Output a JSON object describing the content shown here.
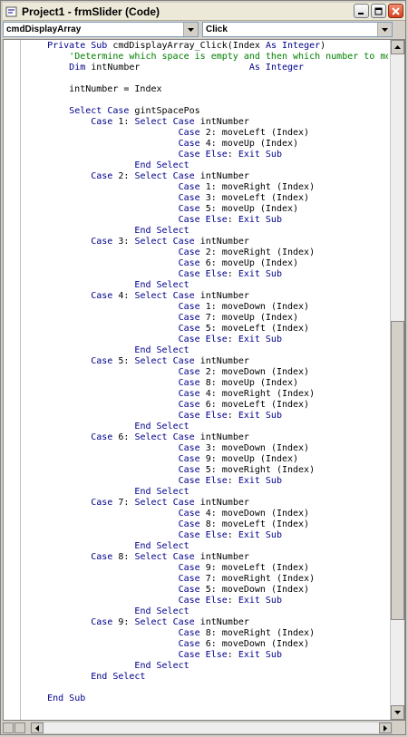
{
  "window": {
    "title": "Project1 - frmSlider (Code)"
  },
  "toolbar": {
    "object_combo": "cmdDisplayArray",
    "procedure_combo": "Click"
  },
  "colors": {
    "keyword": "#00008b",
    "comment": "#008000",
    "text": "#000000"
  },
  "code": [
    [
      {
        "t": "    "
      },
      {
        "t": "Private Sub",
        "k": 1
      },
      {
        "t": " cmdDisplayArray_Click(Index "
      },
      {
        "t": "As Integer",
        "k": 1
      },
      {
        "t": ")"
      }
    ],
    [
      {
        "t": "        "
      },
      {
        "t": "'Determine which space is empty and then which number to move",
        "c": 1
      }
    ],
    [
      {
        "t": "        "
      },
      {
        "t": "Dim",
        "k": 1
      },
      {
        "t": " intNumber                    "
      },
      {
        "t": "As Integer",
        "k": 1
      }
    ],
    [
      {
        "t": ""
      }
    ],
    [
      {
        "t": "        intNumber = Index"
      }
    ],
    [
      {
        "t": ""
      }
    ],
    [
      {
        "t": "        "
      },
      {
        "t": "Select Case",
        "k": 1
      },
      {
        "t": " gintSpacePos"
      }
    ],
    [
      {
        "t": "            "
      },
      {
        "t": "Case",
        "k": 1
      },
      {
        "t": " 1: "
      },
      {
        "t": "Select Case",
        "k": 1
      },
      {
        "t": " intNumber"
      }
    ],
    [
      {
        "t": "                            "
      },
      {
        "t": "Case",
        "k": 1
      },
      {
        "t": " 2: moveLeft (Index)"
      }
    ],
    [
      {
        "t": "                            "
      },
      {
        "t": "Case",
        "k": 1
      },
      {
        "t": " 4: moveUp (Index)"
      }
    ],
    [
      {
        "t": "                            "
      },
      {
        "t": "Case Else",
        "k": 1
      },
      {
        "t": ": "
      },
      {
        "t": "Exit Sub",
        "k": 1
      }
    ],
    [
      {
        "t": "                    "
      },
      {
        "t": "End Select",
        "k": 1
      }
    ],
    [
      {
        "t": "            "
      },
      {
        "t": "Case",
        "k": 1
      },
      {
        "t": " 2: "
      },
      {
        "t": "Select Case",
        "k": 1
      },
      {
        "t": " intNumber"
      }
    ],
    [
      {
        "t": "                            "
      },
      {
        "t": "Case",
        "k": 1
      },
      {
        "t": " 1: moveRight (Index)"
      }
    ],
    [
      {
        "t": "                            "
      },
      {
        "t": "Case",
        "k": 1
      },
      {
        "t": " 3: moveLeft (Index)"
      }
    ],
    [
      {
        "t": "                            "
      },
      {
        "t": "Case",
        "k": 1
      },
      {
        "t": " 5: moveUp (Index)"
      }
    ],
    [
      {
        "t": "                            "
      },
      {
        "t": "Case Else",
        "k": 1
      },
      {
        "t": ": "
      },
      {
        "t": "Exit Sub",
        "k": 1
      }
    ],
    [
      {
        "t": "                    "
      },
      {
        "t": "End Select",
        "k": 1
      }
    ],
    [
      {
        "t": "            "
      },
      {
        "t": "Case",
        "k": 1
      },
      {
        "t": " 3: "
      },
      {
        "t": "Select Case",
        "k": 1
      },
      {
        "t": " intNumber"
      }
    ],
    [
      {
        "t": "                            "
      },
      {
        "t": "Case",
        "k": 1
      },
      {
        "t": " 2: moveRight (Index)"
      }
    ],
    [
      {
        "t": "                            "
      },
      {
        "t": "Case",
        "k": 1
      },
      {
        "t": " 6: moveUp (Index)"
      }
    ],
    [
      {
        "t": "                            "
      },
      {
        "t": "Case Else",
        "k": 1
      },
      {
        "t": ": "
      },
      {
        "t": "Exit Sub",
        "k": 1
      }
    ],
    [
      {
        "t": "                    "
      },
      {
        "t": "End Select",
        "k": 1
      }
    ],
    [
      {
        "t": "            "
      },
      {
        "t": "Case",
        "k": 1
      },
      {
        "t": " 4: "
      },
      {
        "t": "Select Case",
        "k": 1
      },
      {
        "t": " intNumber"
      }
    ],
    [
      {
        "t": "                            "
      },
      {
        "t": "Case",
        "k": 1
      },
      {
        "t": " 1: moveDown (Index)"
      }
    ],
    [
      {
        "t": "                            "
      },
      {
        "t": "Case",
        "k": 1
      },
      {
        "t": " 7: moveUp (Index)"
      }
    ],
    [
      {
        "t": "                            "
      },
      {
        "t": "Case",
        "k": 1
      },
      {
        "t": " 5: moveLeft (Index)"
      }
    ],
    [
      {
        "t": "                            "
      },
      {
        "t": "Case Else",
        "k": 1
      },
      {
        "t": ": "
      },
      {
        "t": "Exit Sub",
        "k": 1
      }
    ],
    [
      {
        "t": "                    "
      },
      {
        "t": "End Select",
        "k": 1
      }
    ],
    [
      {
        "t": "            "
      },
      {
        "t": "Case",
        "k": 1
      },
      {
        "t": " 5: "
      },
      {
        "t": "Select Case",
        "k": 1
      },
      {
        "t": " intNumber"
      }
    ],
    [
      {
        "t": "                            "
      },
      {
        "t": "Case",
        "k": 1
      },
      {
        "t": " 2: moveDown (Index)"
      }
    ],
    [
      {
        "t": "                            "
      },
      {
        "t": "Case",
        "k": 1
      },
      {
        "t": " 8: moveUp (Index)"
      }
    ],
    [
      {
        "t": "                            "
      },
      {
        "t": "Case",
        "k": 1
      },
      {
        "t": " 4: moveRight (Index)"
      }
    ],
    [
      {
        "t": "                            "
      },
      {
        "t": "Case",
        "k": 1
      },
      {
        "t": " 6: moveLeft (Index)"
      }
    ],
    [
      {
        "t": "                            "
      },
      {
        "t": "Case Else",
        "k": 1
      },
      {
        "t": ": "
      },
      {
        "t": "Exit Sub",
        "k": 1
      }
    ],
    [
      {
        "t": "                    "
      },
      {
        "t": "End Select",
        "k": 1
      }
    ],
    [
      {
        "t": "            "
      },
      {
        "t": "Case",
        "k": 1
      },
      {
        "t": " 6: "
      },
      {
        "t": "Select Case",
        "k": 1
      },
      {
        "t": " intNumber"
      }
    ],
    [
      {
        "t": "                            "
      },
      {
        "t": "Case",
        "k": 1
      },
      {
        "t": " 3: moveDown (Index)"
      }
    ],
    [
      {
        "t": "                            "
      },
      {
        "t": "Case",
        "k": 1
      },
      {
        "t": " 9: moveUp (Index)"
      }
    ],
    [
      {
        "t": "                            "
      },
      {
        "t": "Case",
        "k": 1
      },
      {
        "t": " 5: moveRight (Index)"
      }
    ],
    [
      {
        "t": "                            "
      },
      {
        "t": "Case Else",
        "k": 1
      },
      {
        "t": ": "
      },
      {
        "t": "Exit Sub",
        "k": 1
      }
    ],
    [
      {
        "t": "                    "
      },
      {
        "t": "End Select",
        "k": 1
      }
    ],
    [
      {
        "t": "            "
      },
      {
        "t": "Case",
        "k": 1
      },
      {
        "t": " 7: "
      },
      {
        "t": "Select Case",
        "k": 1
      },
      {
        "t": " intNumber"
      }
    ],
    [
      {
        "t": "                            "
      },
      {
        "t": "Case",
        "k": 1
      },
      {
        "t": " 4: moveDown (Index)"
      }
    ],
    [
      {
        "t": "                            "
      },
      {
        "t": "Case",
        "k": 1
      },
      {
        "t": " 8: moveLeft (Index)"
      }
    ],
    [
      {
        "t": "                            "
      },
      {
        "t": "Case Else",
        "k": 1
      },
      {
        "t": ": "
      },
      {
        "t": "Exit Sub",
        "k": 1
      }
    ],
    [
      {
        "t": "                    "
      },
      {
        "t": "End Select",
        "k": 1
      }
    ],
    [
      {
        "t": "            "
      },
      {
        "t": "Case",
        "k": 1
      },
      {
        "t": " 8: "
      },
      {
        "t": "Select Case",
        "k": 1
      },
      {
        "t": " intNumber"
      }
    ],
    [
      {
        "t": "                            "
      },
      {
        "t": "Case",
        "k": 1
      },
      {
        "t": " 9: moveLeft (Index)"
      }
    ],
    [
      {
        "t": "                            "
      },
      {
        "t": "Case",
        "k": 1
      },
      {
        "t": " 7: moveRight (Index)"
      }
    ],
    [
      {
        "t": "                            "
      },
      {
        "t": "Case",
        "k": 1
      },
      {
        "t": " 5: moveDown (Index)"
      }
    ],
    [
      {
        "t": "                            "
      },
      {
        "t": "Case Else",
        "k": 1
      },
      {
        "t": ": "
      },
      {
        "t": "Exit Sub",
        "k": 1
      }
    ],
    [
      {
        "t": "                    "
      },
      {
        "t": "End Select",
        "k": 1
      }
    ],
    [
      {
        "t": "            "
      },
      {
        "t": "Case",
        "k": 1
      },
      {
        "t": " 9: "
      },
      {
        "t": "Select Case",
        "k": 1
      },
      {
        "t": " intNumber"
      }
    ],
    [
      {
        "t": "                            "
      },
      {
        "t": "Case",
        "k": 1
      },
      {
        "t": " 8: moveRight (Index)"
      }
    ],
    [
      {
        "t": "                            "
      },
      {
        "t": "Case",
        "k": 1
      },
      {
        "t": " 6: moveDown (Index)"
      }
    ],
    [
      {
        "t": "                            "
      },
      {
        "t": "Case Else",
        "k": 1
      },
      {
        "t": ": "
      },
      {
        "t": "Exit Sub",
        "k": 1
      }
    ],
    [
      {
        "t": "                    "
      },
      {
        "t": "End Select",
        "k": 1
      }
    ],
    [
      {
        "t": "            "
      },
      {
        "t": "End Select",
        "k": 1
      }
    ],
    [
      {
        "t": ""
      }
    ],
    [
      {
        "t": "    "
      },
      {
        "t": "End Sub",
        "k": 1
      }
    ]
  ]
}
